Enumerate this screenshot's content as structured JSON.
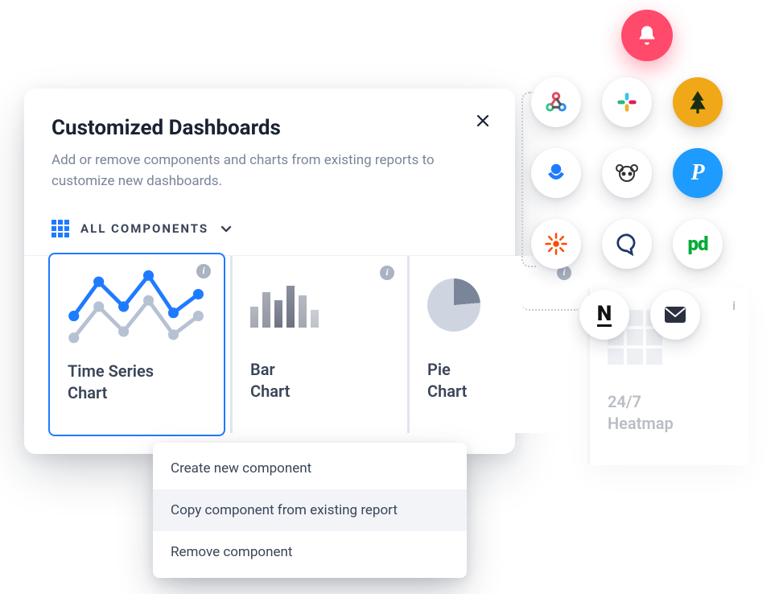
{
  "panel": {
    "title": "Customized Dashboards",
    "description": "Add or remove components and charts from existing reports to customize new dashboards.",
    "filter_label": "ALL COMPONENTS"
  },
  "cards": [
    {
      "label": "Time Series\nChart",
      "icon": "timeseries-icon",
      "selected": true
    },
    {
      "label": "Bar\nChart",
      "icon": "barchart-icon",
      "selected": false
    },
    {
      "label": "Pie\nChart",
      "icon": "piechart-icon",
      "selected": false
    },
    {
      "label": "24/7\nHeatmap",
      "icon": "heatmap-icon",
      "selected": false,
      "faded": true
    }
  ],
  "context_menu": {
    "items": [
      {
        "label": "Create new component",
        "hover": false
      },
      {
        "label": "Copy component from existing report",
        "hover": true
      },
      {
        "label": "Remove component",
        "hover": false
      }
    ]
  },
  "integrations": {
    "bell": "bell-icon",
    "grid": [
      {
        "name": "webhook-icon",
        "color": "#e24b63"
      },
      {
        "name": "slack-icon",
        "color": "#4a154b"
      },
      {
        "name": "treefort-icon",
        "color": "#f0a818"
      },
      {
        "name": "opsgenie-icon",
        "color": "#1e7bff"
      },
      {
        "name": "bear-icon",
        "color": "#333"
      },
      {
        "name": "pushover-icon",
        "color": "#1e9bff"
      },
      {
        "name": "zapier-icon",
        "color": "#ff4a00"
      },
      {
        "name": "chat-icon",
        "color": "#1e3866"
      },
      {
        "name": "pagerduty-icon",
        "color": "#06ac38"
      }
    ],
    "row4": [
      {
        "name": "notion-icon",
        "color": "#111"
      },
      {
        "name": "email-icon",
        "color": "#222"
      }
    ]
  }
}
